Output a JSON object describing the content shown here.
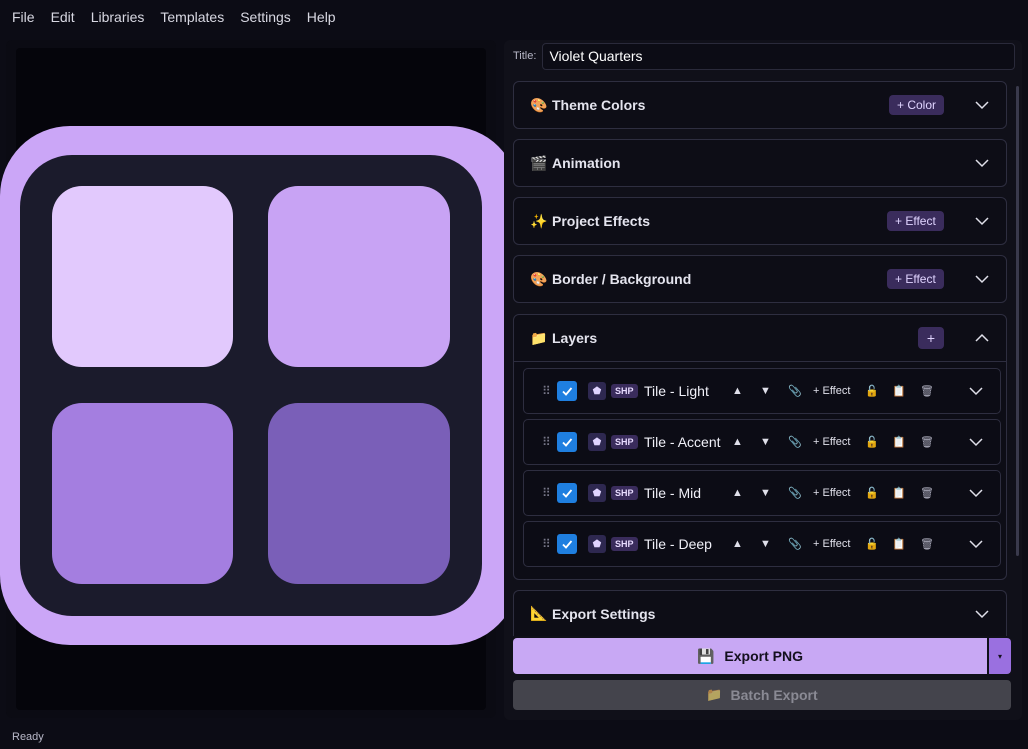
{
  "menu": [
    "File",
    "Edit",
    "Libraries",
    "Templates",
    "Settings",
    "Help"
  ],
  "title": {
    "label": "Title:",
    "value": "Violet Quarters"
  },
  "sections": {
    "theme_colors": {
      "icon": "🎨",
      "label": "Theme Colors",
      "action": "+ Color"
    },
    "animation": {
      "icon": "🎬",
      "label": "Animation"
    },
    "project_effects": {
      "icon": "✨",
      "label": "Project Effects",
      "action": "+ Effect"
    },
    "border_background": {
      "icon": "🎨",
      "label": "Border / Background",
      "action": "+ Effect"
    },
    "layers": {
      "icon": "📁",
      "label": "Layers",
      "action": "+"
    },
    "export_settings": {
      "icon": "📐",
      "label": "Export Settings"
    }
  },
  "layers": [
    {
      "type": "SHP",
      "name": "Tile - Light",
      "enabled": true,
      "effect_label": "+ Effect"
    },
    {
      "type": "SHP",
      "name": "Tile - Accent",
      "enabled": true,
      "effect_label": "+ Effect"
    },
    {
      "type": "SHP",
      "name": "Tile - Mid",
      "enabled": true,
      "effect_label": "+ Effect"
    },
    {
      "type": "SHP",
      "name": "Tile - Deep",
      "enabled": true,
      "effect_label": "+ Effect"
    }
  ],
  "layer_icons": {
    "drag": "⠿",
    "shape": "⬟",
    "up": "▲",
    "down": "▼",
    "pin": "📎",
    "lock": "🔓",
    "copy": "📋",
    "trash": "🗑"
  },
  "export": {
    "icon": "💾",
    "label": "Export PNG",
    "dropdown": "▾"
  },
  "batch": {
    "icon": "📁",
    "label": "Batch Export"
  },
  "status": "Ready",
  "colors": {
    "frame": "#cba6f7",
    "inner": "#1b1b2c",
    "tile_light": "#e2c9fd",
    "tile_accent": "#c8a3f4",
    "tile_mid": "#a47ee0",
    "tile_deep": "#7a5fb8",
    "accent": "#c8a8f4"
  }
}
